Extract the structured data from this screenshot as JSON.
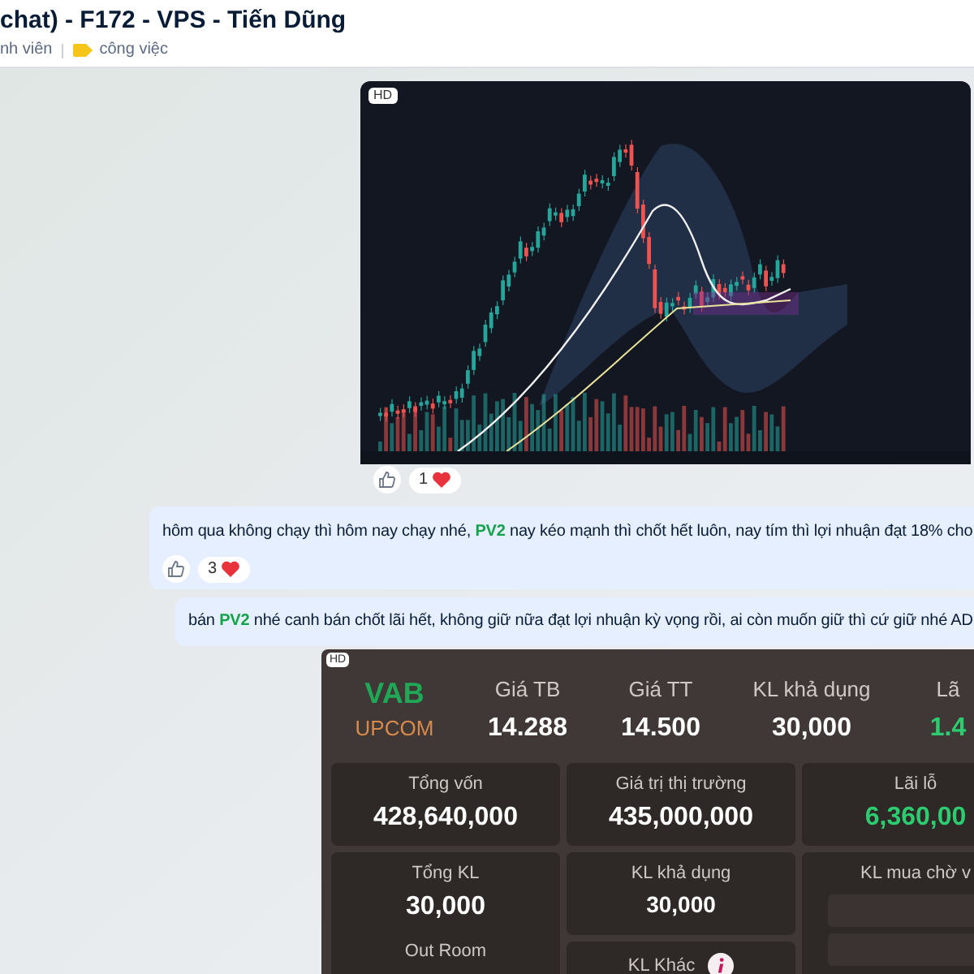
{
  "header": {
    "title": "chat) - F172 - VPS - Tiến Dũng",
    "members": "nh viên",
    "tag": {
      "label": "công việc",
      "color": "#f5c518"
    }
  },
  "messages": [
    {
      "kind": "image",
      "badge": "HD",
      "reactions": {
        "count": "1"
      }
    },
    {
      "kind": "text",
      "segments": [
        {
          "text": "hôm qua không chạy thì hôm nay chạy nhé, ",
          "highlight": false
        },
        {
          "text": "PV2",
          "highlight": true
        },
        {
          "text": " nay kéo mạnh thì chốt hết luôn, nay tím thì lợi nhuận đạt 18% cho",
          "highlight": false
        }
      ],
      "reactions": {
        "count": "3"
      }
    },
    {
      "kind": "text",
      "segments": [
        {
          "text": "bán ",
          "highlight": false
        },
        {
          "text": "PV2",
          "highlight": true
        },
        {
          "text": " nhé canh bán chốt lãi hết, không giữ nữa đạt lợi nhuận kỳ vọng rồi, ai còn muốn giữ thì cứ giữ nhé AD",
          "highlight": false
        }
      ]
    },
    {
      "kind": "position",
      "badge": "HD",
      "symbol": "VAB",
      "exchange": "UPCOM",
      "stats": [
        {
          "label": "Giá TB",
          "value": "14.288",
          "positive": false
        },
        {
          "label": "Giá TT",
          "value": "14.500",
          "positive": false
        },
        {
          "label": "KL khả dụng",
          "value": "30,000",
          "positive": false
        },
        {
          "label": "Lã",
          "value": "1.4",
          "positive": true
        }
      ],
      "columns": [
        [
          {
            "lines": [
              {
                "kind": "label",
                "text": "Tổng vốn"
              },
              {
                "kind": "value",
                "text": "428,640,000",
                "positive": false
              }
            ]
          },
          {
            "lines": [
              {
                "kind": "label",
                "text": "Tổng KL"
              },
              {
                "kind": "value",
                "text": "30,000",
                "positive": false
              },
              {
                "kind": "label",
                "text": "Out Room"
              }
            ]
          }
        ],
        [
          {
            "lines": [
              {
                "kind": "label",
                "text": "Giá trị thị trường"
              },
              {
                "kind": "value",
                "text": "435,000,000",
                "positive": false
              }
            ]
          },
          {
            "lines": [
              {
                "kind": "label",
                "text": "KL khả dụng"
              },
              {
                "kind": "small_value",
                "text": "30,000",
                "positive": false
              }
            ]
          },
          {
            "lines": [
              {
                "kind": "label_info",
                "text": "KL Khác"
              }
            ]
          }
        ],
        [
          {
            "lines": [
              {
                "kind": "label",
                "text": "Lãi lỗ"
              },
              {
                "kind": "value",
                "text": "6,360,00",
                "positive": true
              }
            ]
          },
          {
            "lines": [
              {
                "kind": "label",
                "text": "KL mua chờ v"
              },
              {
                "kind": "bar"
              },
              {
                "kind": "bar"
              }
            ]
          }
        ]
      ]
    }
  ]
}
